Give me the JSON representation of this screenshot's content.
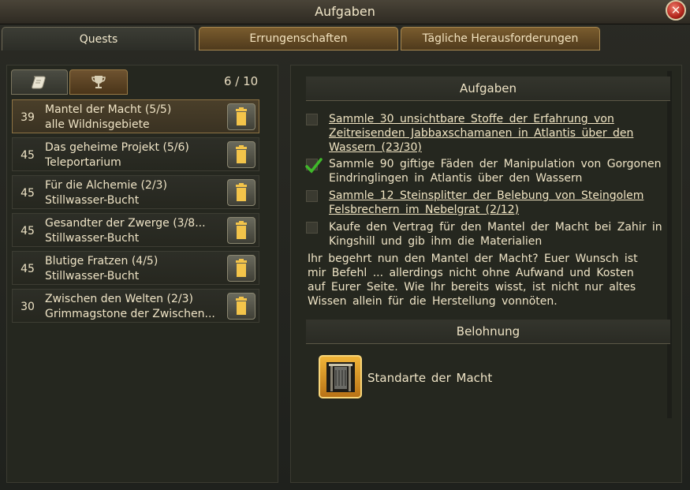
{
  "window": {
    "title": "Aufgaben"
  },
  "tabs": [
    {
      "label": "Quests",
      "active": true
    },
    {
      "label": "Errungenschaften",
      "active": false
    },
    {
      "label": "Tägliche Herausforderungen",
      "active": false
    }
  ],
  "quest_list": {
    "count": "6 / 10",
    "filters": [
      {
        "icon": "scroll-icon",
        "active": true
      },
      {
        "icon": "trophy-icon",
        "active": false
      }
    ],
    "items": [
      {
        "level": "39",
        "name": "Mantel der Macht (5/5)",
        "zone": "alle Wildnisgebiete",
        "selected": true
      },
      {
        "level": "45",
        "name": "Das geheime Projekt (5/6)",
        "zone": "Teleportarium",
        "selected": false
      },
      {
        "level": "45",
        "name": "Für die Alchemie (2/3)",
        "zone": "Stillwasser-Bucht",
        "selected": false
      },
      {
        "level": "45",
        "name": "Gesandter der Zwerge (3/8...",
        "zone": "Stillwasser-Bucht",
        "selected": false
      },
      {
        "level": "45",
        "name": "Blutige Fratzen (4/5)",
        "zone": "Stillwasser-Bucht",
        "selected": false
      },
      {
        "level": "30",
        "name": "Zwischen den Welten (2/3)",
        "zone": "Grimmagstone der Zwischen...",
        "selected": false
      }
    ]
  },
  "details": {
    "header": "Aufgaben",
    "tasks": [
      {
        "text": "Sammle 30 unsichtbare Stoffe der Erfahrung von Zeitreisenden Jabbaxschamanen in Atlantis über den Wassern (23/30)",
        "done": false,
        "link": true
      },
      {
        "text": "Sammle 90 giftige Fäden der Manipulation von Gorgonen Eindringlingen in Atlantis über den Wassern",
        "done": true,
        "link": false
      },
      {
        "text": "Sammle 12 Steinsplitter der Belebung von Steingolem Felsbrechern im Nebelgrat (2/12)",
        "done": false,
        "link": true
      },
      {
        "text": "Kaufe den Vertrag für den Mantel der Macht bei Zahir in Kingshill und gib ihm die Materialien",
        "done": false,
        "link": false
      }
    ],
    "description": "Ihr begehrt nun den Mantel der Macht? Euer Wunsch ist mir Befehl ... allerdings nicht ohne Aufwand und Kosten auf Eurer Seite. Wie Ihr bereits wisst, ist nicht nur altes Wissen allein für die Herstellung vonnöten.",
    "reward_header": "Belohnung",
    "reward": {
      "name": "Standarte der Macht",
      "icon": "banner-icon"
    }
  },
  "colors": {
    "accent_gold": "#f1b438",
    "check_green": "#3fb82a",
    "close_red": "#b2261c"
  }
}
